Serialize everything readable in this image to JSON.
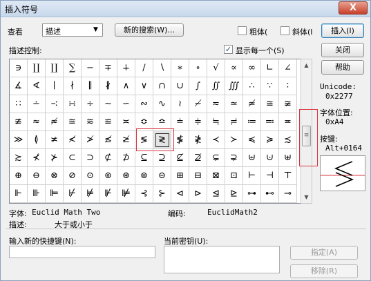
{
  "window": {
    "title": "插入符号",
    "close_glyph": "X"
  },
  "toolbar": {
    "view_label": "查看",
    "view_select": "描述",
    "new_search_label": "新的搜索(W)...",
    "bold_label": "粗体(",
    "italic_label": "斜体(I",
    "insert_label": "插入(I)"
  },
  "desc_control_label": "描述控制:",
  "show_each_label": "显示每一个(S)",
  "show_each_checked": true,
  "right_panel": {
    "close_label": "关闭",
    "help_label": "帮助",
    "unicode_label": "Unicode:",
    "unicode_value": "0x2277",
    "font_pos_label": "字体位置:",
    "font_pos_value": "0xA4",
    "key_label": "按键:",
    "key_value": "Alt+0164"
  },
  "symbols": [
    "∋",
    "∐",
    "∐",
    "∑",
    "−",
    "∓",
    "∔",
    "∕",
    "∖",
    "∗",
    "∘",
    "√",
    "∝",
    "∞",
    "∟",
    "∠",
    "∡",
    "∢",
    "∣",
    "∤",
    "∥",
    "∦",
    "∧",
    "∨",
    "∩",
    "∪",
    "∫",
    "∬",
    "∭",
    "∴",
    "∵",
    "∶",
    "∷",
    "∸",
    "∹",
    "∺",
    "∻",
    "∼",
    "∽",
    "∾",
    "∿",
    "≀",
    "≁",
    "≂",
    "≃",
    "≄",
    "≅",
    "≆",
    "≇",
    "≈",
    "≉",
    "≊",
    "≋",
    "≌",
    "≍",
    "≎",
    "≏",
    "≐",
    "≑",
    "≒",
    "≓",
    "≔",
    "≕",
    "≖",
    "≫",
    "≬",
    "≭",
    "≮",
    "≯",
    "≰",
    "≱",
    "≶",
    "≷",
    "≸",
    "≹",
    "≺",
    "≻",
    "≼",
    "≽",
    "≾",
    "≿",
    "⊀",
    "⊁",
    "⊂",
    "⊃",
    "⊄",
    "⊅",
    "⊆",
    "⊇",
    "⊈",
    "⊉",
    "⊊",
    "⊋",
    "⊌",
    "⊍",
    "⊎",
    "⊕",
    "⊖",
    "⊗",
    "⊘",
    "⊙",
    "⊚",
    "⊛",
    "⊜",
    "⊝",
    "⊞",
    "⊟",
    "⊠",
    "⊡",
    "⊢",
    "⊣",
    "⊤",
    "⊩",
    "⊪",
    "⊫",
    "⊬",
    "⊭",
    "⊮",
    "⊯",
    "⊰",
    "⊱",
    "⊲",
    "⊳",
    "⊴",
    "⊵",
    "⊶",
    "⊷",
    "⊸"
  ],
  "selected_index": 72,
  "scroll_arrows": {
    "up": "▲",
    "down": "▼",
    "grip": "≡"
  },
  "info": {
    "font_label": "字体:",
    "font_value": "Euclid Math Two",
    "code_label": "编码:",
    "code_value": "EuclidMath2",
    "desc_label": "描述:",
    "desc_value": "大于或小于"
  },
  "bottom": {
    "shortcut_label": "输入新的快捷键(N):",
    "shortcut_value": "",
    "current_key_label": "当前密钥(U):",
    "assign_label": "指定(A)",
    "remove_label": "移除(R)"
  },
  "colors": {
    "highlight": "#d9343f",
    "preview_line": "#d9343f"
  }
}
